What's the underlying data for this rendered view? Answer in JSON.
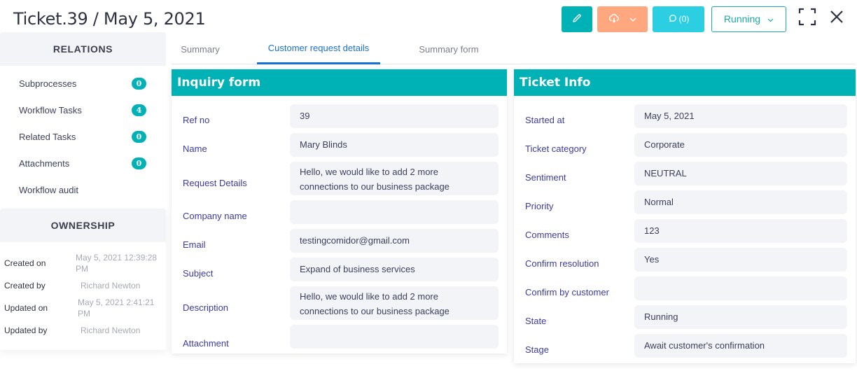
{
  "header": {
    "title": "Ticket.39 / May 5, 2021",
    "toolbar": {
      "edit_icon": "pencil-icon",
      "download_icon": "cloud-download-icon",
      "comments_label": "(0)",
      "comments_icon": "comment-icon",
      "status_label": "Running",
      "expand_icon": "fullscreen-icon",
      "close_icon": "close-icon"
    }
  },
  "sidebar": {
    "relations": {
      "title": "RELATIONS",
      "items": [
        {
          "label": "Subprocesses",
          "count": "0"
        },
        {
          "label": "Workflow Tasks",
          "count": "4"
        },
        {
          "label": "Related Tasks",
          "count": "0"
        },
        {
          "label": "Attachments",
          "count": "0"
        },
        {
          "label": "Workflow audit",
          "count": null
        }
      ]
    },
    "ownership": {
      "title": "OWNERSHIP",
      "rows": [
        {
          "label": "Created on",
          "value": "May 5, 2021 12:39:28 PM"
        },
        {
          "label": "Created by",
          "value": "Richard Newton"
        },
        {
          "label": "Updated on",
          "value": "May 5, 2021 2:41:21 PM"
        },
        {
          "label": "Updated by",
          "value": "Richard Newton"
        }
      ]
    }
  },
  "tabs": [
    {
      "label": "Summary",
      "active": false
    },
    {
      "label": "Customer request details",
      "active": true
    },
    {
      "label": "Summary form",
      "active": false
    }
  ],
  "inquiry_form": {
    "title": "Inquiry form",
    "fields": [
      {
        "label": "Ref no",
        "value": "39"
      },
      {
        "label": "Name",
        "value": "Mary Blinds"
      },
      {
        "label": "Request Details",
        "value": "Hello, we would like to add 2 more connections to our business package"
      },
      {
        "label": "Company name",
        "value": ""
      },
      {
        "label": "Email",
        "value": "testingcomidor@gmail.com"
      },
      {
        "label": "Subject",
        "value": "Expand of business services"
      },
      {
        "label": "Description",
        "value": "Hello, we would like to add 2 more connections to our business package"
      },
      {
        "label": "Attachment",
        "value": ""
      }
    ]
  },
  "ticket_info": {
    "title": "Ticket Info",
    "fields": [
      {
        "label": "Started at",
        "value": "May 5, 2021"
      },
      {
        "label": "Ticket category",
        "value": "Corporate"
      },
      {
        "label": "Sentiment",
        "value": "NEUTRAL"
      },
      {
        "label": "Priority",
        "value": "Normal"
      },
      {
        "label": "Comments",
        "value": "123"
      },
      {
        "label": "Confirm resolution",
        "value": "Yes"
      },
      {
        "label": "Confirm by customer",
        "value": ""
      },
      {
        "label": "State",
        "value": "Running"
      },
      {
        "label": "Stage",
        "value": "Await customer's confirmation"
      }
    ]
  },
  "colors": {
    "teal": "#00b2b5",
    "orange": "#ffa87f",
    "cyan": "#2ccfe2",
    "tab_active": "#1470d6",
    "label_text": "#3b3ba0"
  }
}
